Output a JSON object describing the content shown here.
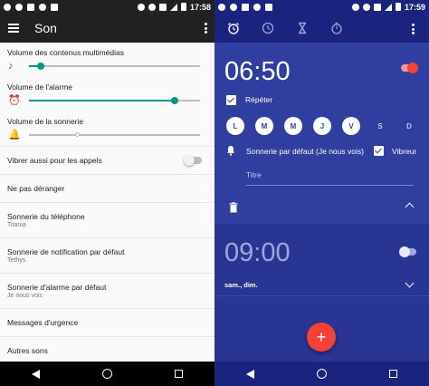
{
  "status": {
    "left_time": "17:58",
    "right_time": "17:59"
  },
  "settings": {
    "title": "Son",
    "sliders": [
      {
        "label": "Volume des contenus multimédias",
        "icon": "music-note-icon",
        "level": 0.07
      },
      {
        "label": "Volume de l'alarme",
        "icon": "alarm-icon",
        "level": 0.85
      },
      {
        "label": "Volume de la sonnerie",
        "icon": "bell-icon",
        "level": 0.28
      }
    ],
    "vibrate_label": "Vibrer aussi pour les appels",
    "items": [
      {
        "title": "Ne pas déranger",
        "sub": ""
      },
      {
        "title": "Sonnerie du téléphone",
        "sub": "Titania"
      },
      {
        "title": "Sonnerie de notification par défaut",
        "sub": "Tethys"
      },
      {
        "title": "Sonnerie d'alarme par défaut",
        "sub": "Je nous vois"
      },
      {
        "title": "Messages d'urgence",
        "sub": ""
      },
      {
        "title": "Autres sons",
        "sub": ""
      }
    ]
  },
  "clock": {
    "tabs": [
      "alarm-tab-icon",
      "clock-tab-icon",
      "timer-tab-icon",
      "stopwatch-tab-icon"
    ],
    "alarm1": {
      "time": "06:50",
      "enabled": true,
      "repeat_label": "Répéter",
      "days": [
        {
          "letter": "L",
          "on": true
        },
        {
          "letter": "M",
          "on": true
        },
        {
          "letter": "M",
          "on": true
        },
        {
          "letter": "J",
          "on": true
        },
        {
          "letter": "V",
          "on": true
        },
        {
          "letter": "S",
          "on": false
        },
        {
          "letter": "D",
          "on": false
        }
      ],
      "ringtone": "Sonnerie par défaut (Je nous vois)",
      "vibrate_label": "Vibreur",
      "label_placeholder": "Titre"
    },
    "alarm2": {
      "time": "09:00",
      "enabled": false,
      "days_summary": "sam., dim."
    },
    "fab_label": "+"
  },
  "colors": {
    "accent": "#009688",
    "alarm_accent": "#f44336",
    "clock_bg": "#283593"
  }
}
